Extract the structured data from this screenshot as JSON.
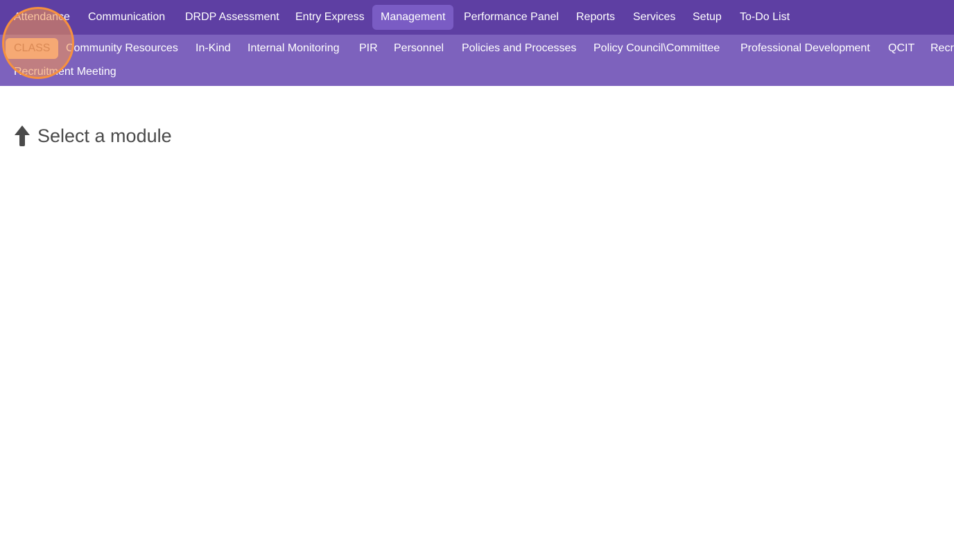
{
  "top_nav": {
    "items": [
      {
        "label": "Attendance"
      },
      {
        "label": "Communication"
      },
      {
        "label": "DRDP Assessment"
      },
      {
        "label": "Entry Express"
      },
      {
        "label": "Management",
        "active": true
      },
      {
        "label": "Performance Panel"
      },
      {
        "label": "Reports"
      },
      {
        "label": "Services"
      },
      {
        "label": "Setup"
      },
      {
        "label": "To-Do List"
      }
    ]
  },
  "sub_nav": {
    "items": [
      {
        "label": "CLASS",
        "selected": true
      },
      {
        "label": "Community Resources"
      },
      {
        "label": "In-Kind"
      },
      {
        "label": "Internal Monitoring"
      },
      {
        "label": "PIR"
      },
      {
        "label": "Personnel"
      },
      {
        "label": "Policies and Processes"
      },
      {
        "label": "Policy Council\\Committee"
      },
      {
        "label": "Professional Development"
      },
      {
        "label": "QCIT"
      },
      {
        "label": "Recru"
      },
      {
        "label": "Recruitment Meeting"
      }
    ]
  },
  "main": {
    "prompt_icon": "arrow-up-icon",
    "prompt_text": "Select a module"
  },
  "colors": {
    "top_nav_bg": "#5e3fa3",
    "top_nav_active": "#7a5cc4",
    "sub_nav_bg": "#7d62bd",
    "selected_pill": "#f3c1a1",
    "highlight_ring": "#f7913e"
  }
}
